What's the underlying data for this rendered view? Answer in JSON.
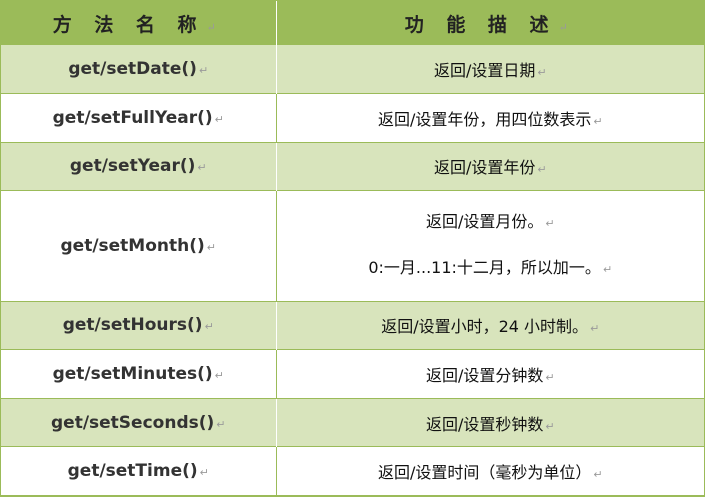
{
  "header": {
    "method_label": "方 法 名 称",
    "desc_label": "功 能 描 述"
  },
  "return_mark": "↵",
  "rows": [
    {
      "method": "get/setDate()",
      "desc": [
        "返回/设置日期"
      ]
    },
    {
      "method": "get/setFullYear()",
      "desc": [
        "返回/设置年份，用四位数表示"
      ]
    },
    {
      "method": "get/setYear()",
      "desc": [
        "返回/设置年份"
      ]
    },
    {
      "method": "get/setMonth()",
      "desc": [
        "返回/设置月份。",
        "0:一月...11:十二月，所以加一。"
      ]
    },
    {
      "method": "get/setHours()",
      "desc": [
        "返回/设置小时，24 小时制。"
      ]
    },
    {
      "method": "get/setMinutes()",
      "desc": [
        "返回/设置分钟数"
      ]
    },
    {
      "method": "get/setSeconds()",
      "desc": [
        "返回/设置秒钟数"
      ]
    },
    {
      "method": "get/setTime()",
      "desc": [
        "返回/设置时间（毫秒为单位）"
      ]
    }
  ],
  "colors": {
    "header_bg": "#9bbb59",
    "band_bg": "#d8e4bc",
    "plain_bg": "#ffffff"
  }
}
